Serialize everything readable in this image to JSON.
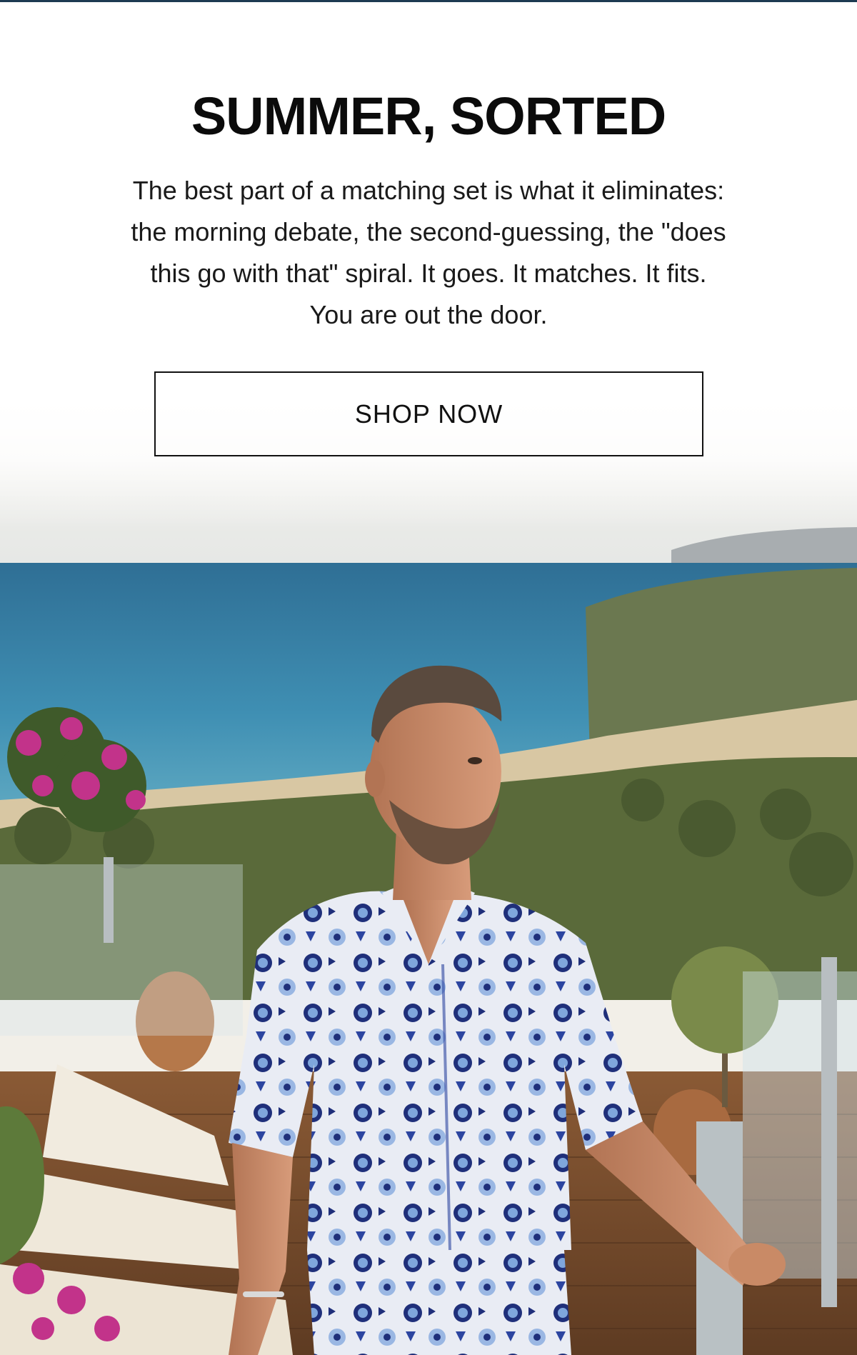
{
  "headline": "SUMMER, SORTED",
  "body_lines": [
    "The best part of a matching set is what it eliminates:",
    "the morning debate, the second-guessing, the \"does",
    "this go with that\" spiral. It goes. It matches. It fits.",
    "You are out the door."
  ],
  "cta": {
    "label": "SHOP NOW"
  },
  "colors": {
    "accent_rule": "#1d3a52",
    "shirt_navy": "#1f2f7a",
    "shirt_light": "#e9ecf4",
    "sea": "#3f8fb3"
  },
  "hero_image": {
    "icon": "lifestyle-photo"
  }
}
